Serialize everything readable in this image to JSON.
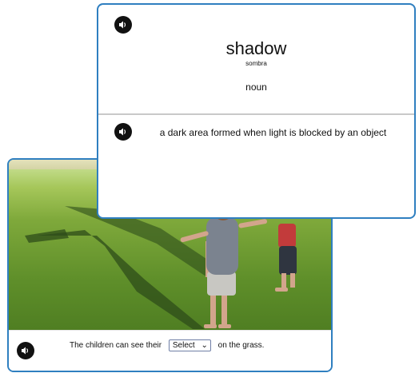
{
  "definition_card": {
    "word": "shadow",
    "translation": "sombra",
    "part_of_speech": "noun",
    "definition": "a dark area formed when light is blocked by an object",
    "word_audio_icon": "speaker-icon",
    "definition_audio_icon": "speaker-icon"
  },
  "sentence_card": {
    "sentence_before": "The children can see their",
    "select_value": "Select",
    "sentence_after": "on the grass.",
    "audio_icon": "speaker-icon"
  },
  "colors": {
    "card_border": "#2f7fc0",
    "text": "#111111",
    "divider": "#c9c9c9"
  }
}
